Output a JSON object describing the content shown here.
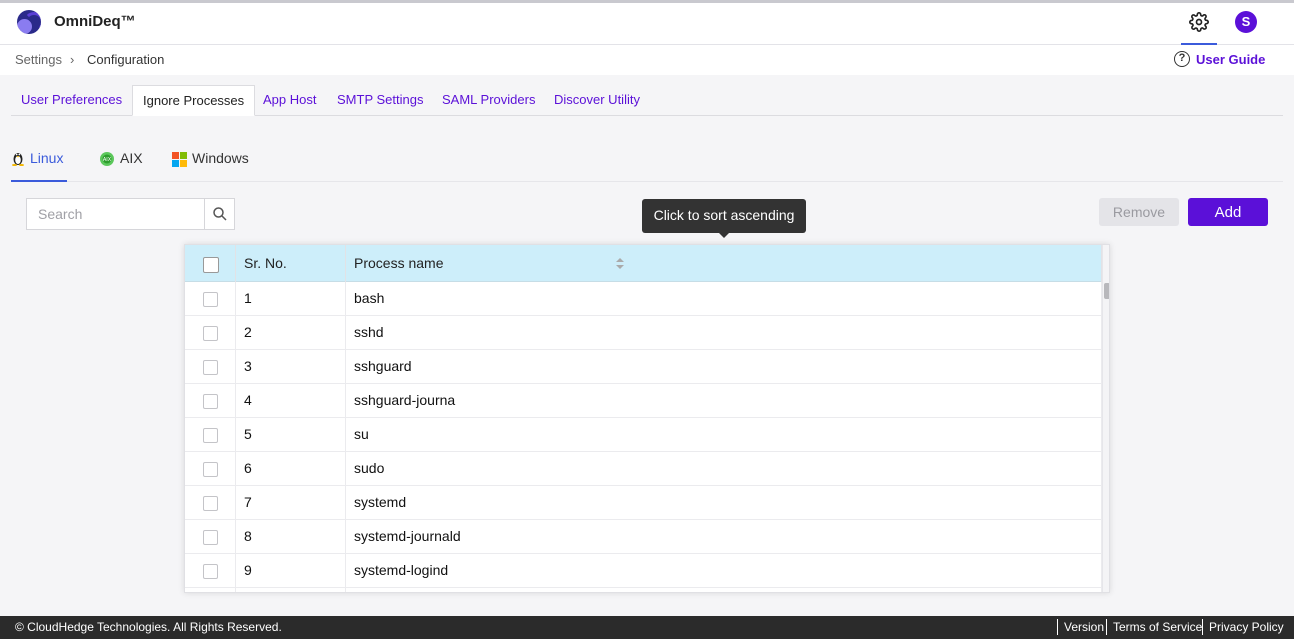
{
  "app": {
    "title": "OmniDeq™",
    "user_initial": "S"
  },
  "breadcrumb": {
    "root": "Settings",
    "separator": "›",
    "current": "Configuration"
  },
  "user_guide": {
    "label": "User Guide",
    "icon": "?"
  },
  "tabs": [
    {
      "label": "User Preferences"
    },
    {
      "label": "Ignore Processes"
    },
    {
      "label": "App Host"
    },
    {
      "label": "SMTP Settings"
    },
    {
      "label": "SAML Providers"
    },
    {
      "label": "Discover Utility"
    }
  ],
  "os_tabs": [
    {
      "label": "Linux"
    },
    {
      "label": "AIX"
    },
    {
      "label": "Windows"
    }
  ],
  "search": {
    "placeholder": "Search",
    "value": ""
  },
  "buttons": {
    "remove": "Remove",
    "add": "Add"
  },
  "tooltip": "Click to sort ascending",
  "table": {
    "headers": {
      "sr": "Sr. No.",
      "name": "Process name"
    },
    "rows": [
      {
        "sr": "1",
        "name": "bash"
      },
      {
        "sr": "2",
        "name": "sshd"
      },
      {
        "sr": "3",
        "name": "sshguard"
      },
      {
        "sr": "4",
        "name": "sshguard-journa"
      },
      {
        "sr": "5",
        "name": "su"
      },
      {
        "sr": "6",
        "name": "sudo"
      },
      {
        "sr": "7",
        "name": "systemd"
      },
      {
        "sr": "8",
        "name": "systemd-journald"
      },
      {
        "sr": "9",
        "name": "systemd-logind"
      }
    ]
  },
  "footer": {
    "copyright": "© CloudHedge Technologies. All Rights Reserved.",
    "links": {
      "version": "Version",
      "terms": "Terms of Service",
      "privacy": "Privacy Policy"
    }
  },
  "colors": {
    "accent": "#5b10d8",
    "tab_active": "#3b5bdb",
    "header_bg": "#cdeefa",
    "footer_bg": "#2b2b2b"
  }
}
